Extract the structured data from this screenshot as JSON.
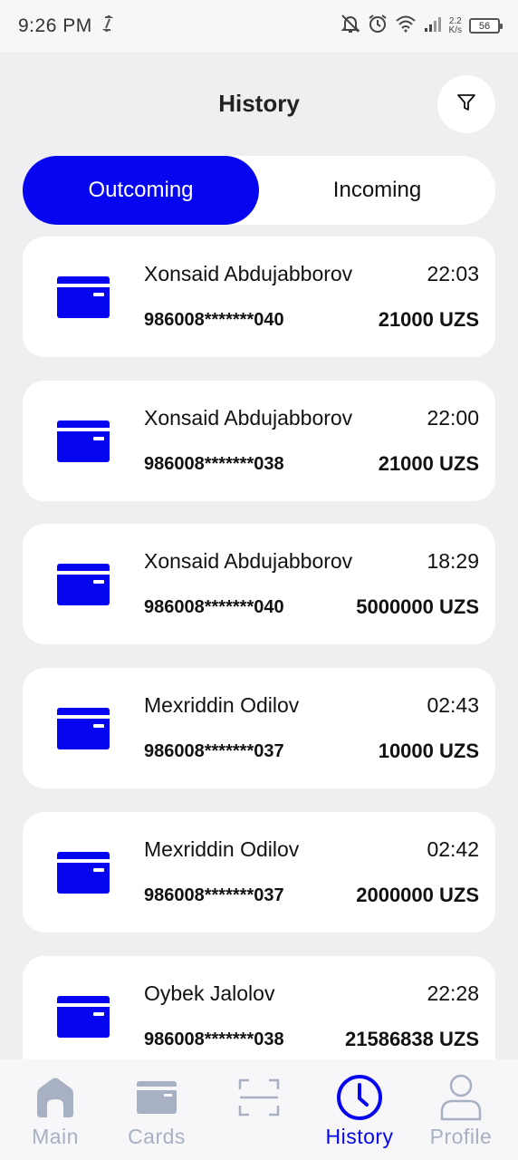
{
  "status_bar": {
    "time": "9:26 PM",
    "net_speed_value": "2.2",
    "net_speed_unit": "K/s",
    "battery": "56"
  },
  "header": {
    "title": "History"
  },
  "tabs": [
    {
      "label": "Outcoming",
      "active": true
    },
    {
      "label": "Incoming",
      "active": false
    }
  ],
  "transactions": [
    {
      "name": "Xonsaid Abdujabborov",
      "time": "22:03",
      "card_number": "986008*******040",
      "amount": "21000 UZS"
    },
    {
      "name": "Xonsaid Abdujabborov",
      "time": "22:00",
      "card_number": "986008*******038",
      "amount": "21000 UZS"
    },
    {
      "name": "Xonsaid Abdujabborov",
      "time": "18:29",
      "card_number": "986008*******040",
      "amount": "5000000 UZS"
    },
    {
      "name": "Mexriddin Odilov",
      "time": "02:43",
      "card_number": "986008*******037",
      "amount": "10000 UZS"
    },
    {
      "name": "Mexriddin Odilov",
      "time": "02:42",
      "card_number": "986008*******037",
      "amount": "2000000 UZS"
    },
    {
      "name": "Oybek Jalolov",
      "time": "22:28",
      "card_number": "986008*******038",
      "amount": "21586838 UZS"
    }
  ],
  "bottom_nav": [
    {
      "label": "Main",
      "icon": "home-icon",
      "active": false
    },
    {
      "label": "Cards",
      "icon": "wallet-icon",
      "active": false
    },
    {
      "label": "",
      "icon": "scan-icon",
      "active": false
    },
    {
      "label": "History",
      "icon": "clock-icon",
      "active": true
    },
    {
      "label": "Profile",
      "icon": "user-icon",
      "active": false
    }
  ],
  "colors": {
    "accent": "#0505ef",
    "background": "#efeef0",
    "inactive_nav": "#a7b1c3"
  }
}
